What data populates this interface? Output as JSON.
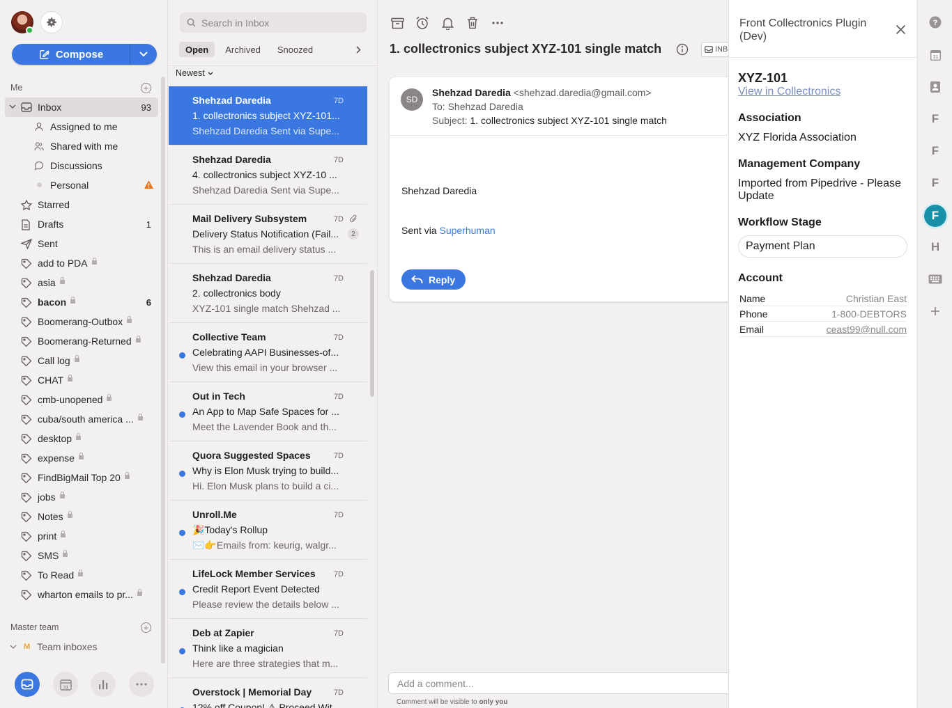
{
  "sidebar": {
    "compose_label": "Compose",
    "me_section": "Me",
    "master_section": "Master team",
    "team_inboxes": "Team inboxes",
    "team_letter": "M",
    "items": [
      {
        "label": "Inbox",
        "count": "93"
      },
      {
        "label": "Assigned to me"
      },
      {
        "label": "Shared with me"
      },
      {
        "label": "Discussions"
      },
      {
        "label": "Personal"
      },
      {
        "label": "Starred"
      },
      {
        "label": "Drafts",
        "count": "1"
      },
      {
        "label": "Sent"
      },
      {
        "label": "add to PDA"
      },
      {
        "label": "asia"
      },
      {
        "label": "bacon",
        "count": "6"
      },
      {
        "label": "Boomerang-Outbox"
      },
      {
        "label": "Boomerang-Returned"
      },
      {
        "label": "Call log"
      },
      {
        "label": "CHAT"
      },
      {
        "label": "cmb-unopened"
      },
      {
        "label": "cuba/south america ..."
      },
      {
        "label": "desktop"
      },
      {
        "label": "expense"
      },
      {
        "label": "FindBigMail Top 20"
      },
      {
        "label": "jobs"
      },
      {
        "label": "Notes"
      },
      {
        "label": "print"
      },
      {
        "label": "SMS"
      },
      {
        "label": "To Read"
      },
      {
        "label": "wharton emails to pr..."
      }
    ]
  },
  "list": {
    "search_placeholder": "Search in Inbox",
    "tabs": [
      "Open",
      "Archived",
      "Snoozed"
    ],
    "sort_label": "Newest",
    "messages": [
      {
        "from": "Shehzad Daredia",
        "date": "7D",
        "subject": "1. collectronics subject XYZ-101...",
        "preview": "Shehzad Daredia Sent via Supe..."
      },
      {
        "from": "Shehzad Daredia",
        "date": "7D",
        "subject": "4. collectronics subject XYZ-10 ...",
        "preview": "Shehzad Daredia Sent via Supe..."
      },
      {
        "from": "Mail Delivery Subsystem",
        "date": "7D",
        "subject": "Delivery Status Notification (Fail...",
        "preview": "This is an email delivery status ...",
        "thread_count": "2"
      },
      {
        "from": "Shehzad Daredia",
        "date": "7D",
        "subject": "2. collectronics body",
        "preview": "XYZ-101 single match Shehzad ..."
      },
      {
        "from": "Collective Team",
        "date": "7D",
        "subject": "Celebrating AAPI Businesses-of...",
        "preview": "View this email in your browser ..."
      },
      {
        "from": "Out in Tech",
        "date": "7D",
        "subject": "An App to Map Safe Spaces for ...",
        "preview": "Meet the Lavender Book and th..."
      },
      {
        "from": "Quora Suggested Spaces",
        "date": "7D",
        "subject": "Why is Elon Musk trying to build...",
        "preview": "Hi. Elon Musk plans to build a ci..."
      },
      {
        "from": "Unroll.Me",
        "date": "7D",
        "subject": "🎉Today's Rollup",
        "preview": "✉️👉Emails from: keurig, walgr..."
      },
      {
        "from": "LifeLock Member Services",
        "date": "7D",
        "subject": "Credit Report Event Detected",
        "preview": "Please review the details below ..."
      },
      {
        "from": "Deb at Zapier",
        "date": "7D",
        "subject": "Think like a magician",
        "preview": "Here are three strategies that m..."
      },
      {
        "from": "Overstock | Memorial Day",
        "date": "7D",
        "subject": "12% off Coupon! ⚠ Proceed Wit...",
        "preview": ""
      }
    ]
  },
  "conversation": {
    "title": "1. collectronics subject XYZ-101 single match",
    "inbox_chip": "INB",
    "sender_initials": "SD",
    "sender_name": "Shehzad Daredia",
    "sender_email": "<shehzad.daredia@gmail.com>",
    "to_line": "To: Shehzad Daredia",
    "subject_prefix": "Subject:",
    "subject": "1. collectronics subject XYZ-101 single match",
    "body_name": "Shehzad Daredia",
    "body_sent_via": "Sent via",
    "body_link": "Superhuman",
    "reply_label": "Reply",
    "comment_placeholder": "Add a comment...",
    "comment_note_prefix": "Comment will be visible to",
    "comment_note_bold": "only you"
  },
  "plugin": {
    "title": "Front Collectronics Plugin (Dev)",
    "ticket_id": "XYZ-101",
    "view_link": "View in Collectronics",
    "association_heading": "Association",
    "association_value": "XYZ Florida Association",
    "mgmt_heading": "Management Company",
    "mgmt_value": "Imported from Pipedrive - Please Update",
    "stage_heading": "Workflow Stage",
    "stage_value": "Payment Plan",
    "account_heading": "Account",
    "account": [
      {
        "label": "Name",
        "value": "Christian East"
      },
      {
        "label": "Phone",
        "value": "1-800-DEBTORS"
      },
      {
        "label": "Email",
        "value": "ceast99@null.com"
      }
    ]
  },
  "rail": {
    "letters": [
      "F",
      "F",
      "F",
      "F",
      "H"
    ],
    "calendar_day": "31"
  },
  "colors": {
    "accent": "#3b77e0",
    "plugin_active": "#1a8fa8",
    "warning": "#e8751a"
  }
}
